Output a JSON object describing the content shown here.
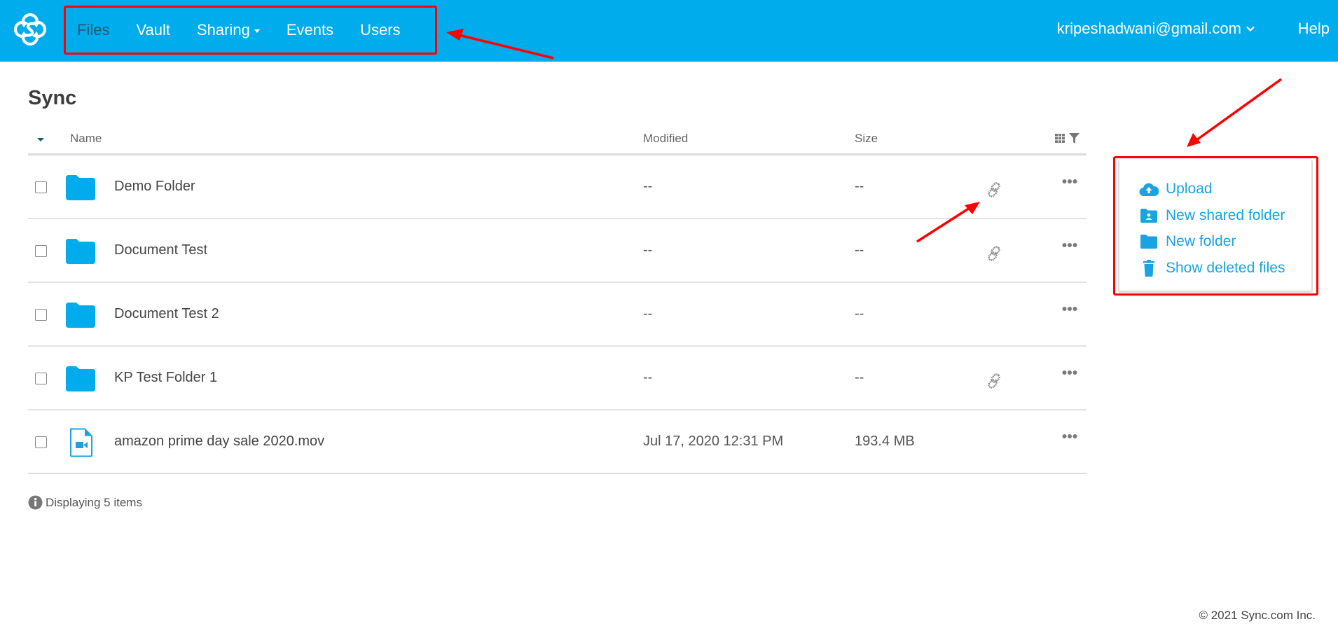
{
  "header": {
    "logo": "sync-logo-icon",
    "nav": [
      {
        "label": "Files",
        "active": true
      },
      {
        "label": "Vault",
        "active": false
      },
      {
        "label": "Sharing",
        "active": false,
        "has_dropdown": true
      },
      {
        "label": "Events",
        "active": false
      },
      {
        "label": "Users",
        "active": false
      }
    ],
    "user_email": "kripeshadwani@gmail.com",
    "help_label": "Help"
  },
  "page": {
    "title": "Sync"
  },
  "table": {
    "columns": {
      "name": "Name",
      "modified": "Modified",
      "size": "Size"
    },
    "rows": [
      {
        "type": "folder",
        "name": "Demo Folder",
        "modified": "--",
        "size": "--",
        "shared_link": true
      },
      {
        "type": "folder",
        "name": "Document Test",
        "modified": "--",
        "size": "--",
        "shared_link": true
      },
      {
        "type": "folder",
        "name": "Document Test 2",
        "modified": "--",
        "size": "--",
        "shared_link": false
      },
      {
        "type": "folder",
        "name": "KP Test Folder 1",
        "modified": "--",
        "size": "--",
        "shared_link": true
      },
      {
        "type": "video",
        "name": "amazon prime day sale 2020.mov",
        "modified": "Jul 17, 2020 12:31 PM",
        "size": "193.4 MB",
        "shared_link": false
      }
    ],
    "item_count": "Displaying 5 items"
  },
  "actions": [
    {
      "label": "Upload",
      "icon": "cloud-upload-icon"
    },
    {
      "label": "New shared folder",
      "icon": "shared-folder-icon"
    },
    {
      "label": "New folder",
      "icon": "folder-icon"
    },
    {
      "label": "Show deleted files",
      "icon": "trash-icon"
    }
  ],
  "footer": {
    "copyright": "© 2021 Sync.com Inc."
  },
  "colors": {
    "brand_blue": "#00acec",
    "link_blue": "#1aa3e0",
    "active_nav": "#1f5a78",
    "annotation_red": "#ff0000"
  }
}
